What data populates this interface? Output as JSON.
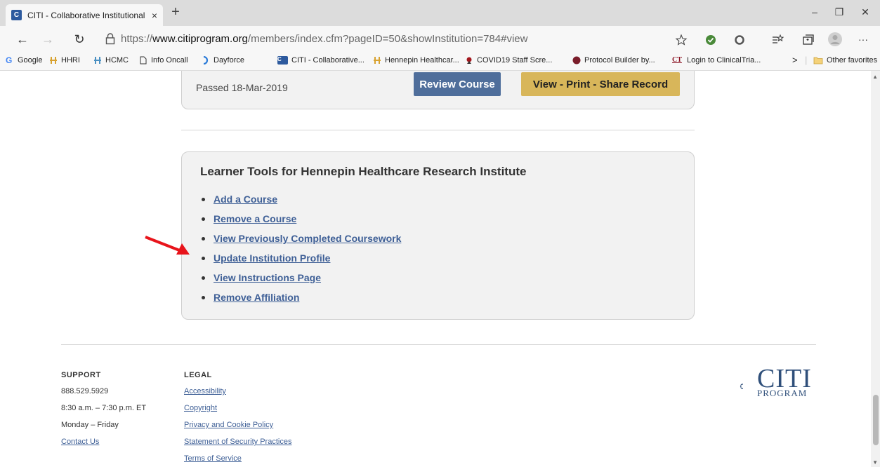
{
  "browser": {
    "tab_title": "CITI - Collaborative Institutional",
    "favicon_letter": "C",
    "url_scheme": "https://",
    "url_domain": "www.citiprogram.org",
    "url_path": "/members/index.cfm?pageID=50&showInstitution=784#view",
    "new_tab": "+",
    "close_tab": "×",
    "win_min": "–",
    "win_max": "❐",
    "win_close": "✕",
    "back": "←",
    "forward": "→",
    "refresh": "↻",
    "more": "···",
    "bookmarks_more": ">",
    "bookmarks": [
      "Google",
      "HHRI",
      "HCMC",
      "Info Oncall",
      "Dayforce",
      "CITI - Collaborative...",
      "Hennepin Healthcar...",
      "COVID19 Staff Scre...",
      "Protocol Builder by...",
      "Login to ClinicalTria..."
    ],
    "other_favorites": "Other favorites"
  },
  "record": {
    "passed": "Passed 18-Mar-2019",
    "review_button": "Review Course",
    "record_button": "View - Print - Share Record"
  },
  "tools": {
    "title": "Learner Tools for Hennepin Healthcare Research Institute",
    "items": [
      "Add a Course",
      "Remove a Course",
      "View Previously Completed Coursework",
      "Update Institution Profile",
      "View Instructions Page",
      "Remove Affiliation"
    ]
  },
  "footer": {
    "support_heading": "SUPPORT",
    "phone": "888.529.5929",
    "hours": "8:30 a.m. – 7:30 p.m. ET",
    "days": "Monday – Friday",
    "contact": "Contact Us",
    "legal_heading": "LEGAL",
    "legal_links": [
      "Accessibility",
      "Copyright",
      "Privacy and Cookie Policy",
      "Statement of Security Practices",
      "Terms of Service"
    ]
  },
  "logo": {
    "main": "CITI",
    "sub": "PROGRAM"
  },
  "colors": {
    "link": "#3e5f96",
    "review_button": "#4f6e9b",
    "record_button": "#d8b65a",
    "annotation_arrow": "#e8141b"
  }
}
